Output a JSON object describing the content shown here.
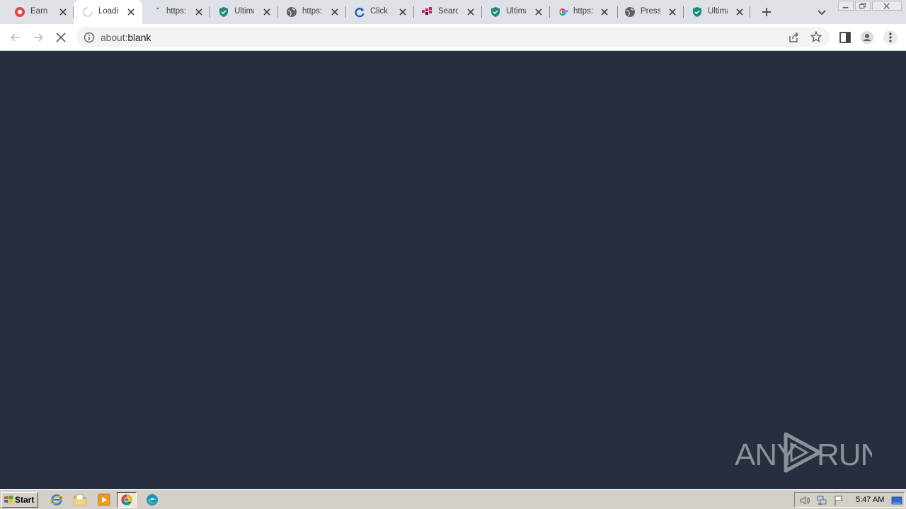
{
  "browser": {
    "tabs": [
      {
        "title": "Earn m",
        "icon": "red-circle-icon",
        "active": false
      },
      {
        "title": "Loadin",
        "icon": "loading-spinner-icon",
        "active": true
      },
      {
        "title": "https:/",
        "icon": "blank-page-icon",
        "active": false
      },
      {
        "title": "Ultima",
        "icon": "shield-icon",
        "active": false
      },
      {
        "title": "https:/",
        "icon": "globe-icon",
        "active": false
      },
      {
        "title": "Click A",
        "icon": "refresh-logo-icon",
        "active": false
      },
      {
        "title": "Search",
        "icon": "grid-logo-icon",
        "active": false
      },
      {
        "title": "Ultima",
        "icon": "shield-icon",
        "active": false
      },
      {
        "title": "https:/",
        "icon": "google-icon",
        "active": false
      },
      {
        "title": "Press /",
        "icon": "globe-icon",
        "active": false
      },
      {
        "title": "Ultima",
        "icon": "shield-icon",
        "active": false
      }
    ],
    "address": {
      "scheme": "about:",
      "rest": "blank"
    },
    "colors": {
      "tabstrip": "#dee1e6",
      "content_bg": "#252f3e",
      "shield": "#1e8c7e"
    }
  },
  "watermark": {
    "left": "ANY",
    "right": "RUN"
  },
  "taskbar": {
    "start_label": "Start",
    "clock": "5:47 AM"
  }
}
